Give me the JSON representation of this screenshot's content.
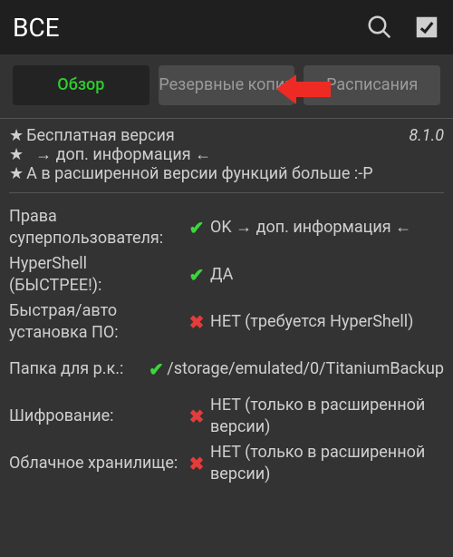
{
  "topbar": {
    "title": "ВСЕ"
  },
  "tabs": {
    "overview": "Обзор",
    "backups": "Резервные копии",
    "schedules": "Расписания"
  },
  "info": {
    "line1": "Бесплатная версия",
    "version": "8.1.0",
    "line2": "→ доп. информация ←",
    "line3": "А в расширенной версии функций больше :-P"
  },
  "rows": {
    "root": {
      "label": "Права суперпользователя:",
      "value": "OK → доп. информация ←"
    },
    "hypershell": {
      "label": "HyperShell (БЫСТРЕЕ!):",
      "value": "ДА"
    },
    "fastinstall": {
      "label": "Быстрая/авто установка ПО:",
      "value": "НЕТ (требуется HyperShell)"
    },
    "folder": {
      "label": "Папка для р.к.:",
      "value": "/storage/emulated/0/TitaniumBackup"
    },
    "encryption": {
      "label": "Шифрование:",
      "value": "НЕТ (только в расширенной версии)"
    },
    "cloud": {
      "label": "Облачное хранилище:",
      "value": "НЕТ (только в расширенной версии)"
    }
  }
}
